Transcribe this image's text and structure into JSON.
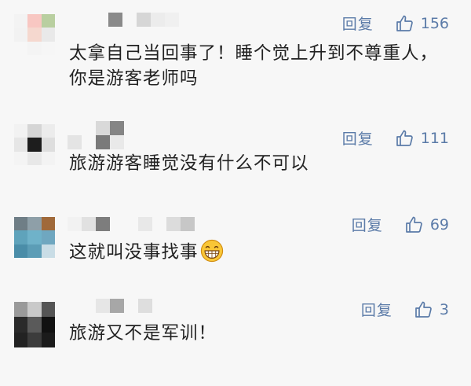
{
  "comments": [
    {
      "reply_label": "回复",
      "likes": "156",
      "text": "太拿自己当回事了！睡个觉上升到不尊重人，你是游客老师吗"
    },
    {
      "reply_label": "回复",
      "likes": "111",
      "text": "旅游游客睡觉没有什么不可以"
    },
    {
      "reply_label": "回复",
      "likes": "69",
      "text": "这就叫没事找事",
      "emoji": "grinning-emoji"
    },
    {
      "reply_label": "回复",
      "likes": "3",
      "text": "旅游又不是军训！"
    }
  ],
  "colors": {
    "background": "#f7f7f7",
    "action_blue": "#5b7ba8",
    "text": "#222222"
  },
  "icons": [
    "like-thumbs-up-icon",
    "grinning-emoji"
  ]
}
